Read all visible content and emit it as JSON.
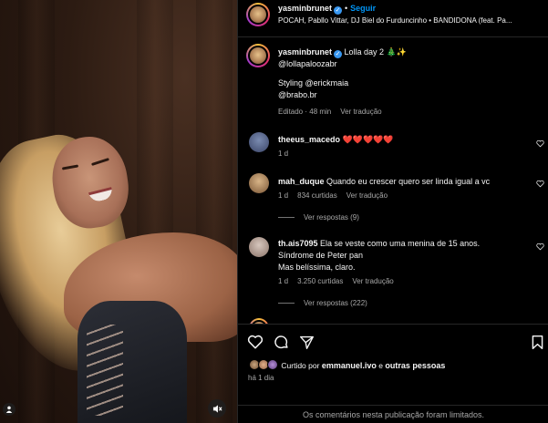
{
  "header": {
    "username": "yasminbrunet",
    "follow_label": "Seguir",
    "audio": "POCAH, Pabllo Vittar, DJ Biel do Furduncinho • BANDIDONA (feat. Pa..."
  },
  "caption": {
    "username": "yasminbrunet",
    "line1": "Lolla day 2 🎄✨",
    "line2": "@lollapaloozabr",
    "line3": "Styling @erickmaia",
    "line4": "@brabo.br",
    "time": "Editado · 48 min",
    "translate": "Ver tradução"
  },
  "comments": [
    {
      "username": "theeus_macedo",
      "text": "❤️❤️❤️❤️❤️",
      "time": "1 d"
    },
    {
      "username": "mah_duque",
      "text": "Quando eu crescer quero ser linda igual a vc",
      "time": "1 d",
      "likes": "834 curtidas",
      "translate": "Ver tradução",
      "replies": "Ver respostas (9)"
    },
    {
      "username": "th.ais7095",
      "text_line1": "Ela se veste como uma menina de 15 anos.",
      "text_line2": "Síndrome de Peter pan",
      "text_line3": "Mas belíssima, claro.",
      "time": "1 d",
      "likes": "3.250 curtidas",
      "translate": "Ver tradução",
      "replies": "Ver respostas (222)"
    }
  ],
  "likes": {
    "prefix": "Curtido por",
    "user": "emmanuel.ivo",
    "conjunction": "e",
    "others": "outras pessoas"
  },
  "post_date": "há 1 dia",
  "comments_limited": "Os comentários nesta publicação foram limitados."
}
